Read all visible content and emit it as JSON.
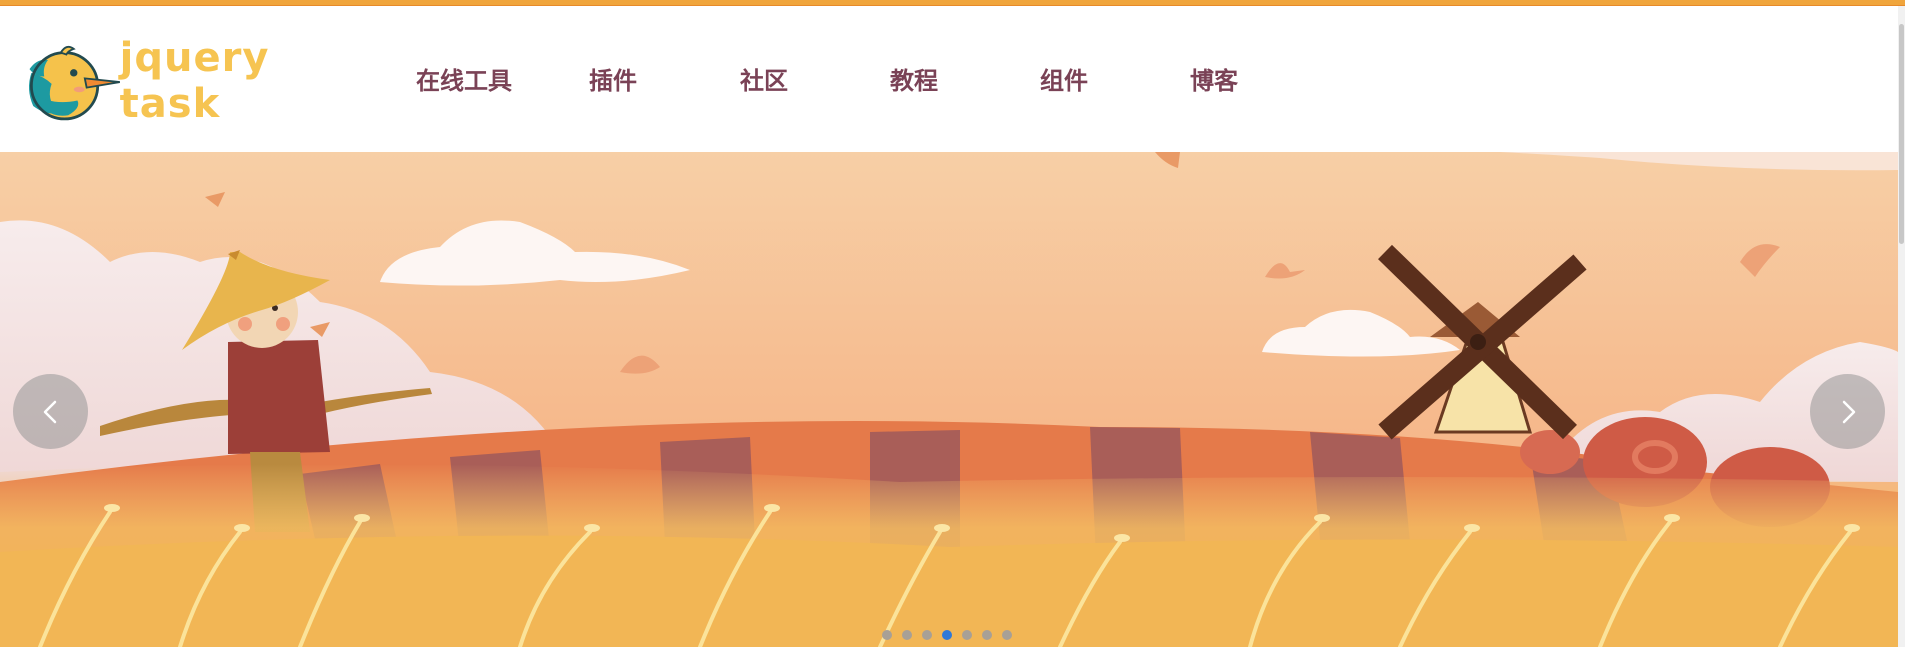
{
  "brand": {
    "logo_text": "jquery task",
    "logo_color": "#f6c451",
    "logo_icon": "bird-mascot-icon"
  },
  "nav": {
    "items": [
      {
        "label": "在线工具"
      },
      {
        "label": "插件"
      },
      {
        "label": "社区"
      },
      {
        "label": "教程"
      },
      {
        "label": "组件"
      },
      {
        "label": "博客"
      }
    ],
    "text_color": "#7a4256"
  },
  "slider": {
    "scene": "autumn-field-scarecrow-windmill-illustration",
    "prev_icon": "chevron-left-icon",
    "next_icon": "chevron-right-icon",
    "slide_count": 7,
    "active_index": 4,
    "dot_color": "#a8a096",
    "active_dot_color": "#2f79d8"
  },
  "colors": {
    "top_accent": "#f0a53c",
    "sky": "#f6c49a",
    "field": "#f2b65c"
  }
}
